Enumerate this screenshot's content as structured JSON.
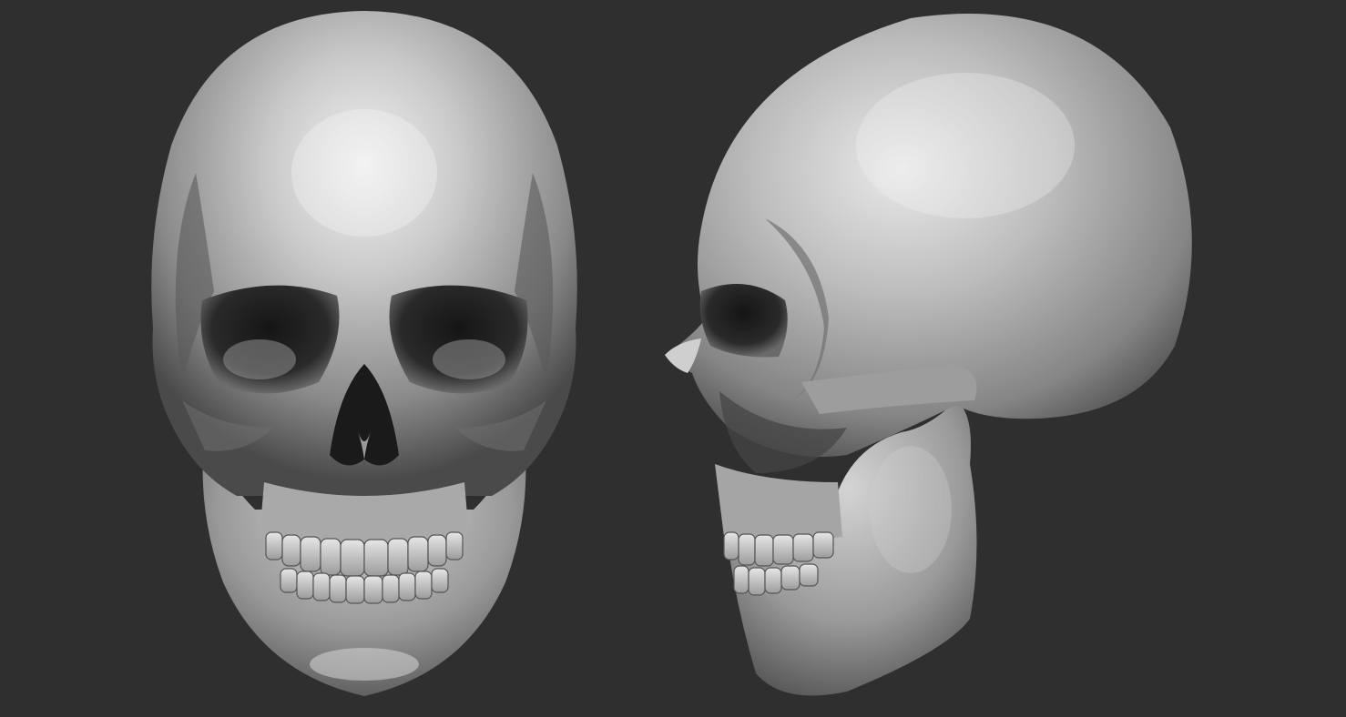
{
  "scene": {
    "background_color": "#2f2f2f",
    "material_color": "#b4b4b4",
    "views": [
      {
        "name": "front-view",
        "subject": "skull-front"
      },
      {
        "name": "side-view",
        "subject": "skull-side"
      }
    ]
  }
}
